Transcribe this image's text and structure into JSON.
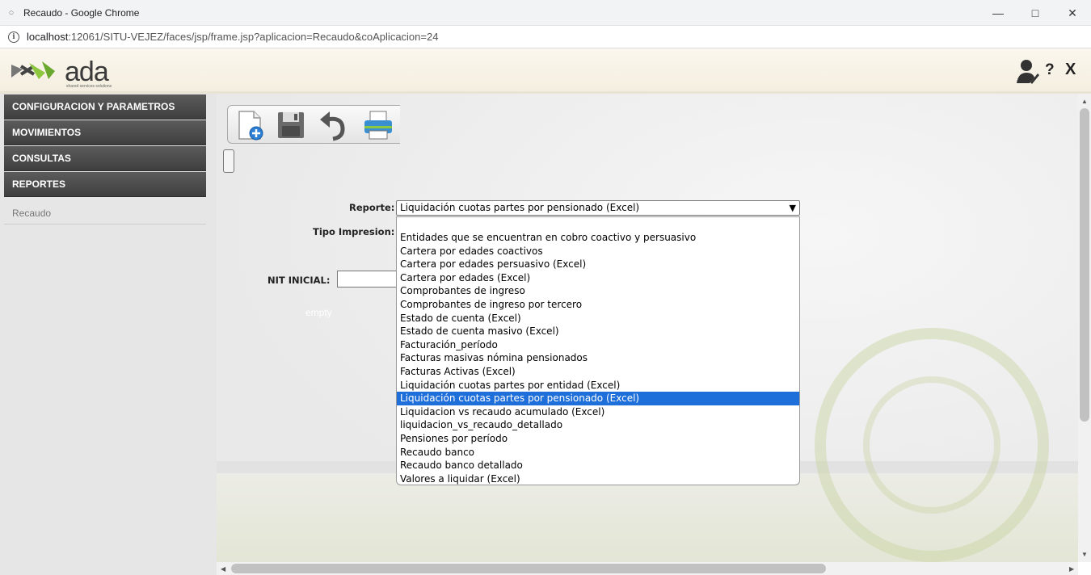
{
  "window": {
    "title": "Recaudo - Google Chrome"
  },
  "address": {
    "host": "localhost",
    "rest": ":12061/SITU-VEJEZ/faces/jsp/frame.jsp?aplicacion=Recaudo&coAplicacion=24"
  },
  "header": {
    "logo_text": "ada",
    "logo_tagline": "shared services solutions",
    "help": "?",
    "close": "X"
  },
  "sidebar": {
    "items": [
      {
        "label": "CONFIGURACION Y PARAMETROS"
      },
      {
        "label": "MOVIMIENTOS"
      },
      {
        "label": "CONSULTAS"
      },
      {
        "label": "REPORTES"
      }
    ],
    "sub_item": "Recaudo"
  },
  "form": {
    "reporte_label": "Reporte:",
    "tipo_label": "Tipo Impresion:",
    "nit_label": "NIT INICIAL:",
    "selected_report": "Liquidación cuotas partes por pensionado (Excel)",
    "empty_text": "empty",
    "options": [
      "",
      "Entidades que se encuentran en cobro coactivo y persuasivo",
      "Cartera por edades coactivos",
      "Cartera por edades persuasivo (Excel)",
      "Cartera por edades (Excel)",
      "Comprobantes de ingreso",
      "Comprobantes de ingreso por tercero",
      "Estado de cuenta (Excel)",
      "Estado de cuenta masivo (Excel)",
      "Facturación_período",
      "Facturas masivas nómina pensionados",
      "Facturas Activas (Excel)",
      "Liquidación cuotas partes por entidad (Excel)",
      "Liquidación cuotas partes por pensionado (Excel)",
      "Liquidacion vs recaudo acumulado (Excel)",
      "liquidacion_vs_recaudo_detallado",
      "Pensiones por período",
      "Recaudo banco",
      "Recaudo banco detallado",
      "Valores a liquidar (Excel)"
    ],
    "selected_index": 13
  },
  "colors": {
    "menu_bg": "#4a4a4a",
    "selection": "#1e6fd9",
    "logo_green": "#8dc63f"
  }
}
